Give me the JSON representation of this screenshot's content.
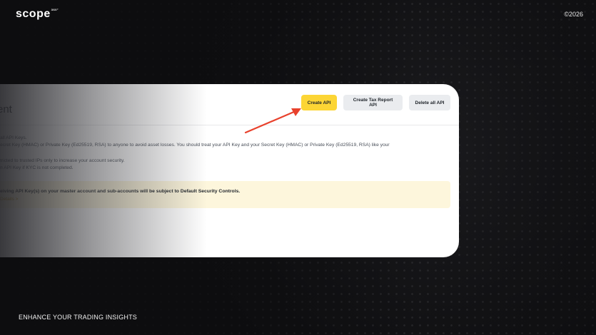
{
  "brand": {
    "logo": "scope",
    "logo_mark": "360°",
    "copyright": "©2026"
  },
  "tagline": "ENHANCE YOUR TRADING INSIGHTS",
  "api_page": {
    "heading": "ent",
    "buttons": {
      "create": "Create API",
      "tax_report": "Create Tax Report API",
      "delete_all": "Delete all API"
    },
    "lines": [
      "all API Keys.",
      "ecret Key (HMAC) or Private Key (Ed25519, RSA) to anyone to avoid asset losses. You should treat your API Key and your Secret Key (HMAC) or Private Key (Ed25519, RSA) like your",
      "tricted to trusted IPs only to increase your account security.",
      "n API Key if KYC is not completed."
    ],
    "notice": {
      "text": "eiving API Key(s) on your master account and sub-accounts will be subject to Default Security Controls.",
      "link": "Details >"
    }
  },
  "colors": {
    "accent_yellow": "#fcd535",
    "arrow_red": "#e8412c"
  },
  "icons": {
    "annotation": "arrow-icon"
  }
}
